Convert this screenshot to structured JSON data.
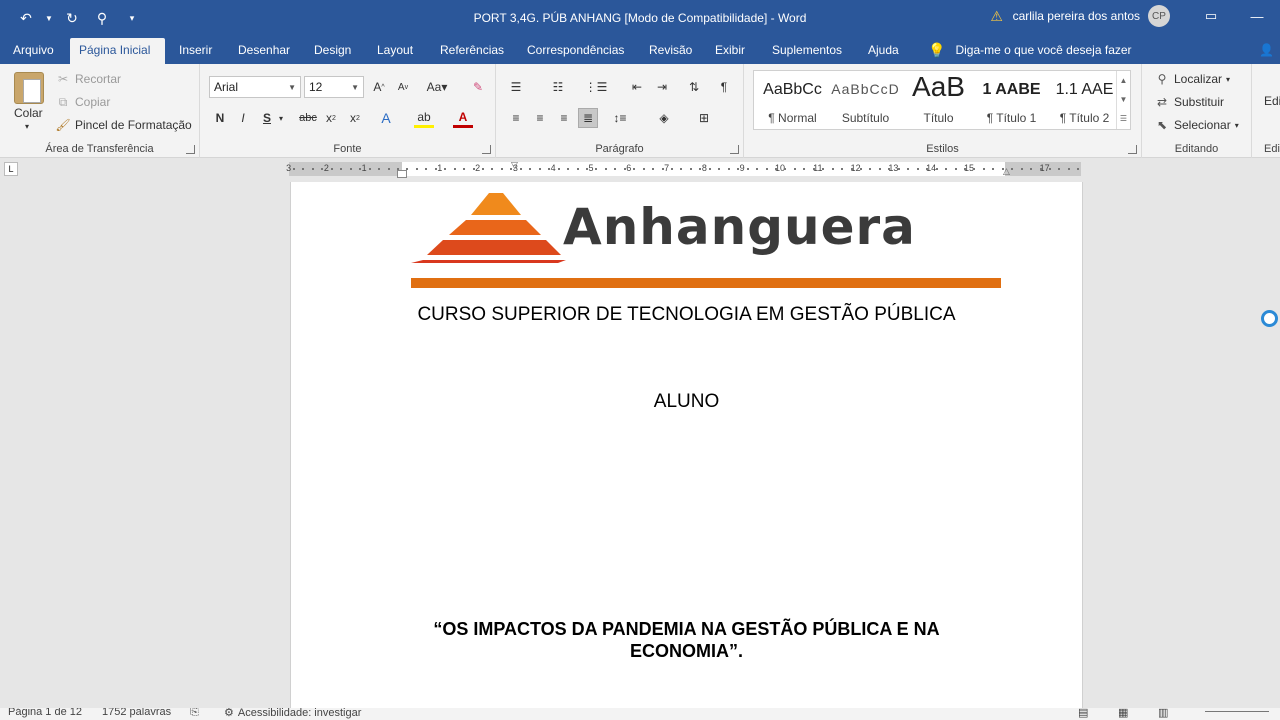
{
  "titlebar": {
    "document_title": "PORT 3,4G. PÚB ANHANG [Modo de Compatibilidade]  -  Word",
    "user_name": "carlila pereira dos antos",
    "avatar_initials": "CP"
  },
  "tabs": [
    {
      "label": "Arquivo"
    },
    {
      "label": "Página Inicial"
    },
    {
      "label": "Inserir"
    },
    {
      "label": "Desenhar"
    },
    {
      "label": "Design"
    },
    {
      "label": "Layout"
    },
    {
      "label": "Referências"
    },
    {
      "label": "Correspondências"
    },
    {
      "label": "Revisão"
    },
    {
      "label": "Exibir"
    },
    {
      "label": "Suplementos"
    },
    {
      "label": "Ajuda"
    }
  ],
  "active_tab": "Página Inicial",
  "tell_me": "Diga-me o que você deseja fazer",
  "share_label": "C",
  "clipboard": {
    "group_label": "Área de Transferência",
    "paste": "Colar",
    "cut": "Recortar",
    "copy": "Copiar",
    "format_painter": "Pincel de Formatação"
  },
  "font": {
    "group_label": "Fonte",
    "font_name": "Arial",
    "font_size": "12"
  },
  "paragraph": {
    "group_label": "Parágrafo"
  },
  "styles": {
    "group_label": "Estilos",
    "items": [
      {
        "sample": "AaBbCc",
        "name": "¶ Normal"
      },
      {
        "sample": "AaBbCcD",
        "name": "Subtítulo"
      },
      {
        "sample": "AaB",
        "name": "Título"
      },
      {
        "sample": "1  AABE",
        "name": "¶ Título 1"
      },
      {
        "sample": "1.1  AAE",
        "name": "¶ Título 2"
      }
    ]
  },
  "editing": {
    "group_label": "Editando",
    "find": "Localizar",
    "replace": "Substituir",
    "select": "Selecionar",
    "next_group_partial": "Edi"
  },
  "ruler": {
    "numbers_left": [
      "3",
      "2",
      "1"
    ],
    "numbers_right": [
      "1",
      "2",
      "3",
      "4",
      "5",
      "6",
      "7",
      "8",
      "9",
      "10",
      "11",
      "12",
      "13",
      "14",
      "15",
      "17"
    ]
  },
  "document": {
    "logo_text": "Anhanguera",
    "course": "CURSO SUPERIOR DE TECNOLOGIA EM GESTÃO PÚBLICA",
    "student": "ALUNO",
    "thesis_line1": "“OS IMPACTOS DA PANDEMIA NA GESTÃO PÚBLICA E NA",
    "thesis_line2": "ECONOMIA”."
  },
  "statusbar": {
    "page": "Página 1 de 12",
    "words": "1752 palavras",
    "accessibility": "Acessibilidade: investigar"
  },
  "colors": {
    "word_blue": "#2b579a",
    "logo_orange": "#e06f11",
    "logo_red": "#d9381e",
    "logo_gray": "#3b3b3b"
  }
}
